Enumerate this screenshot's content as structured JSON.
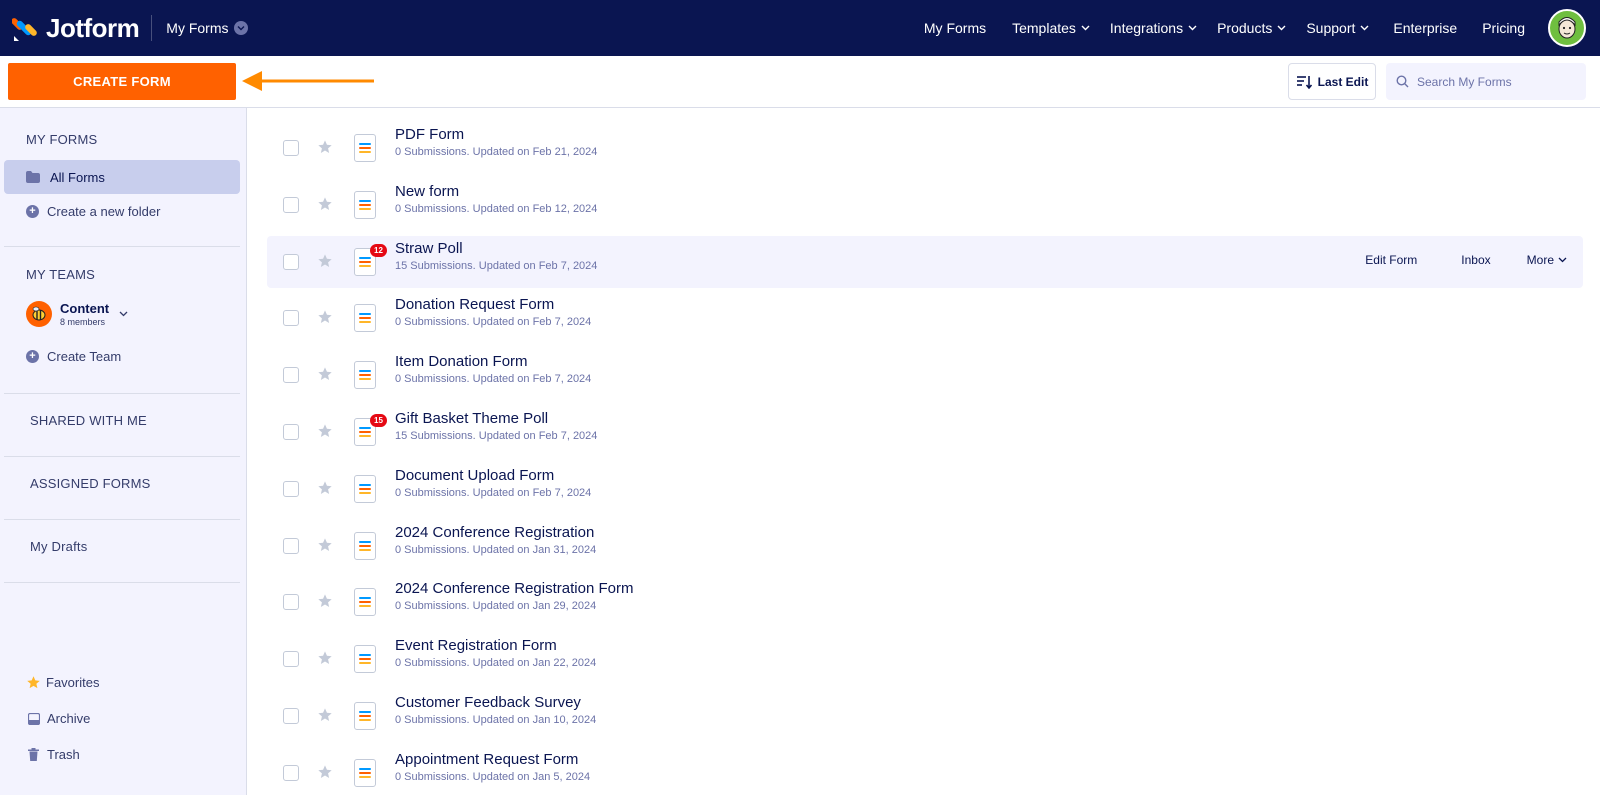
{
  "header": {
    "brand": "Jotform",
    "my_forms_dropdown": "My Forms",
    "nav": [
      {
        "label": "My Forms",
        "has_chevron": false
      },
      {
        "label": "Templates",
        "has_chevron": true
      },
      {
        "label": "Integrations",
        "has_chevron": true
      },
      {
        "label": "Products",
        "has_chevron": true
      },
      {
        "label": "Support",
        "has_chevron": true
      },
      {
        "label": "Enterprise",
        "has_chevron": false
      },
      {
        "label": "Pricing",
        "has_chevron": false
      }
    ]
  },
  "toolbar": {
    "create_label": "CREATE FORM",
    "sort_label": "Last Edit",
    "search_placeholder": "Search My Forms"
  },
  "sidebar": {
    "my_forms_heading": "MY FORMS",
    "all_forms": "All Forms",
    "create_folder": "Create a new folder",
    "my_teams_heading": "MY TEAMS",
    "team": {
      "name": "Content",
      "members": "8 members"
    },
    "create_team": "Create Team",
    "shared_with_me": "SHARED WITH ME",
    "assigned_forms": "ASSIGNED FORMS",
    "my_drafts": "My Drafts",
    "favorites": "Favorites",
    "archive": "Archive",
    "trash": "Trash"
  },
  "forms": [
    {
      "title": "PDF Form",
      "meta": "0 Submissions. Updated on Feb 21, 2024",
      "badge": ""
    },
    {
      "title": "New form",
      "meta": "0 Submissions. Updated on Feb 12, 2024",
      "badge": ""
    },
    {
      "title": "Straw Poll",
      "meta": "15 Submissions. Updated on Feb 7, 2024",
      "badge": "12"
    },
    {
      "title": "Donation Request Form",
      "meta": "0 Submissions. Updated on Feb 7, 2024",
      "badge": ""
    },
    {
      "title": "Item Donation Form",
      "meta": "0 Submissions. Updated on Feb 7, 2024",
      "badge": ""
    },
    {
      "title": "Gift Basket Theme Poll",
      "meta": "15 Submissions. Updated on Feb 7, 2024",
      "badge": "15"
    },
    {
      "title": "Document Upload Form",
      "meta": "0 Submissions. Updated on Feb 7, 2024",
      "badge": ""
    },
    {
      "title": "2024 Conference Registration",
      "meta": "0 Submissions. Updated on Jan 31, 2024",
      "badge": ""
    },
    {
      "title": "2024 Conference Registration Form",
      "meta": "0 Submissions. Updated on Jan 29, 2024",
      "badge": ""
    },
    {
      "title": "Event Registration Form",
      "meta": "0 Submissions. Updated on Jan 22, 2024",
      "badge": ""
    },
    {
      "title": "Customer Feedback Survey",
      "meta": "0 Submissions. Updated on Jan 10, 2024",
      "badge": ""
    },
    {
      "title": "Appointment Request Form",
      "meta": "0 Submissions. Updated on Jan 5, 2024",
      "badge": ""
    }
  ],
  "row_actions": {
    "edit": "Edit Form",
    "inbox": "Inbox",
    "more": "More"
  },
  "hovered_row_index": 2,
  "colors": {
    "navy": "#0a1551",
    "orange": "#ff6100",
    "sidebar_bg": "#f3f3fe",
    "active_item": "#c8ceed",
    "badge_red": "#e50914",
    "avatar_green": "#6fbf3f"
  }
}
